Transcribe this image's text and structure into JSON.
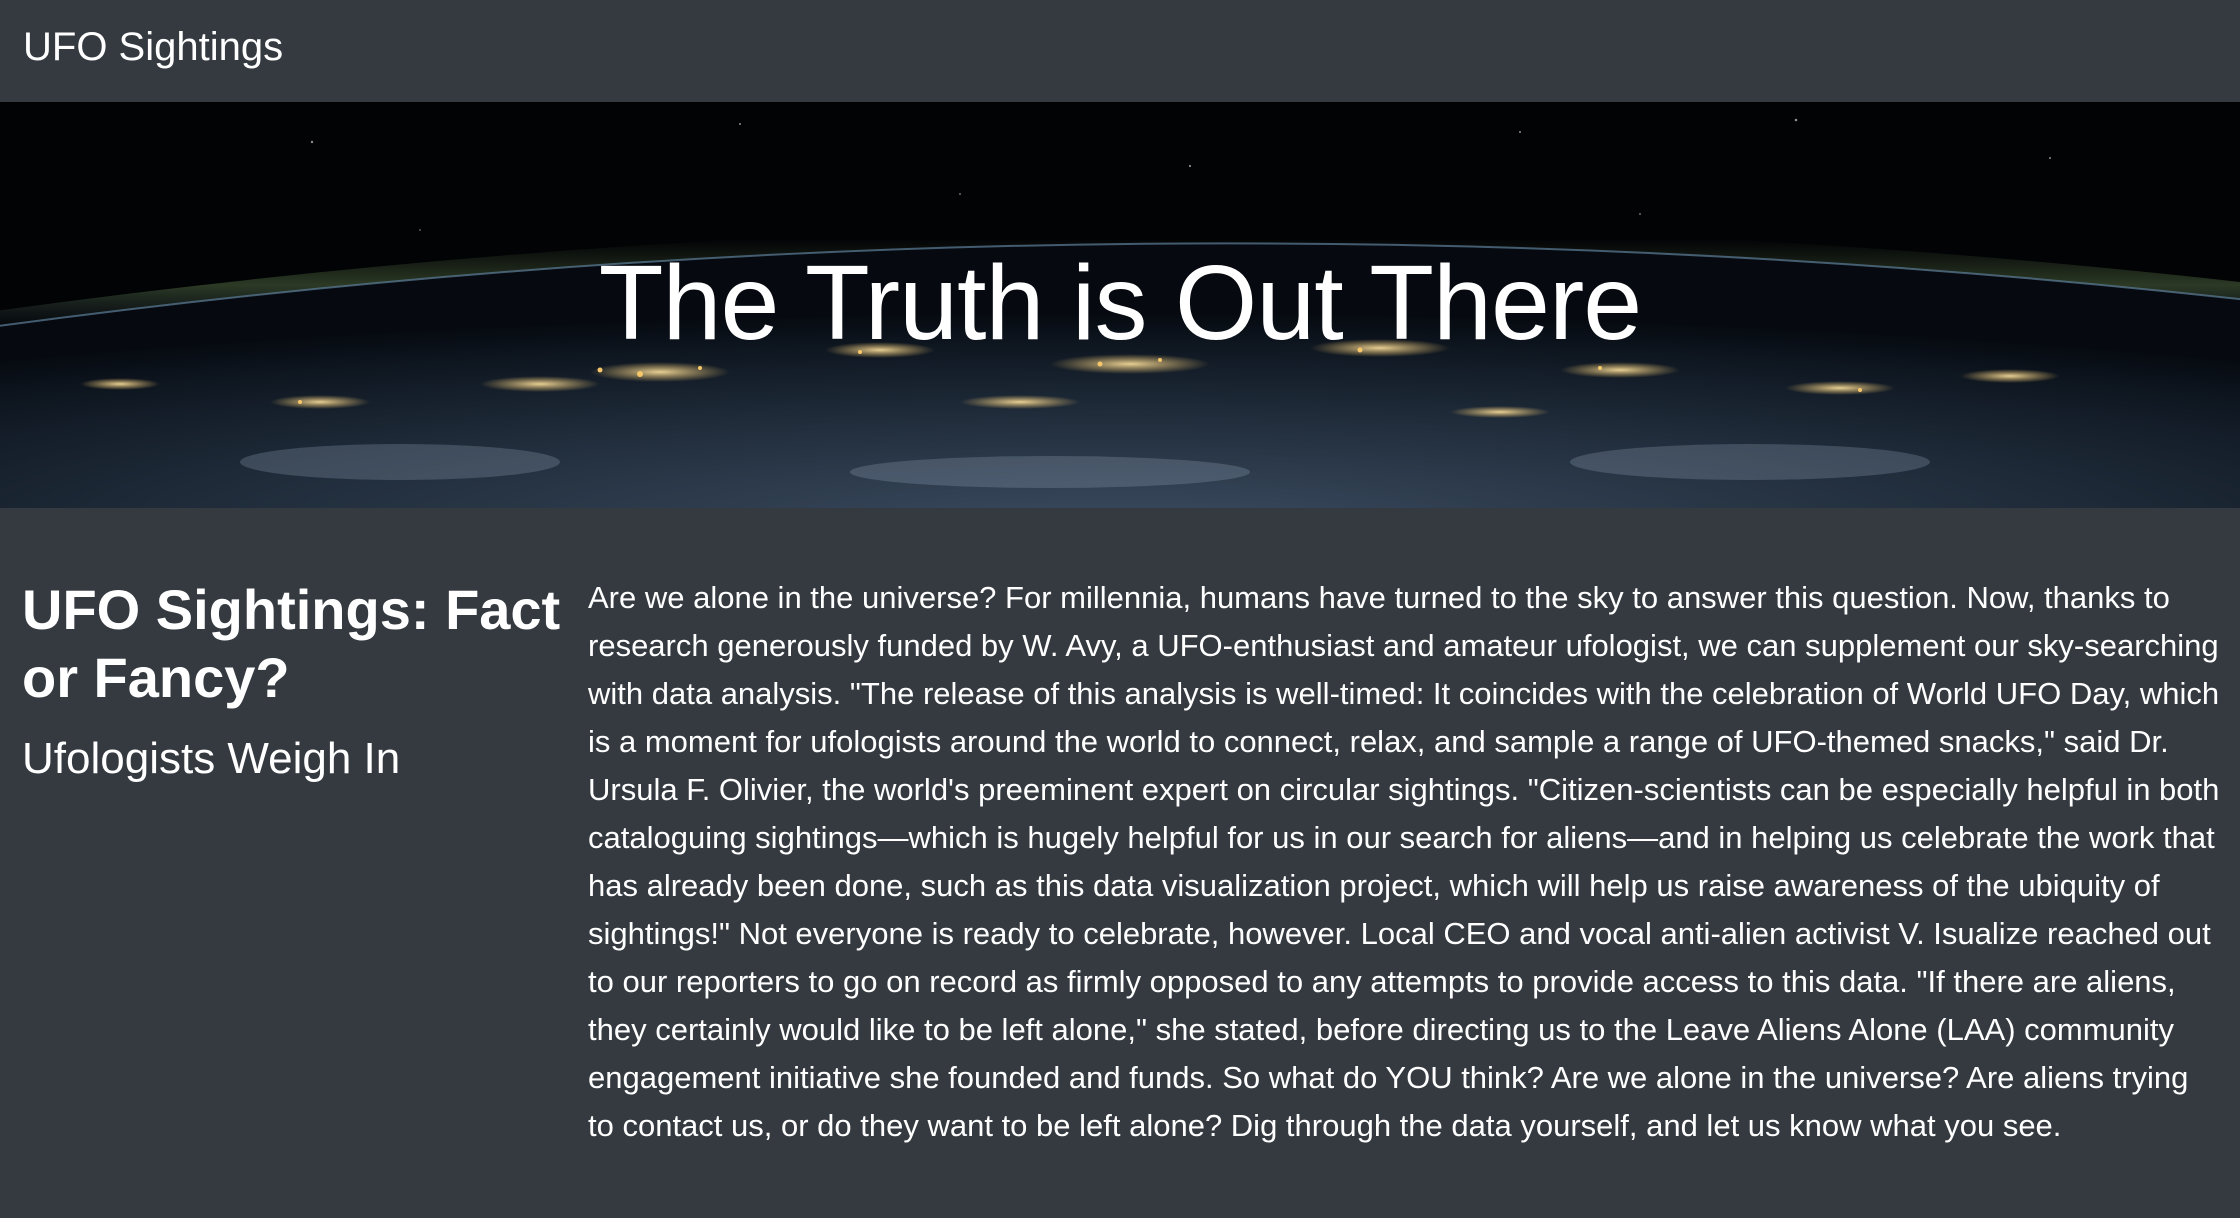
{
  "navbar": {
    "brand": "UFO Sightings"
  },
  "hero": {
    "title": "The Truth is Out There",
    "background": "earth-at-night-from-space"
  },
  "sidebar": {
    "heading": "UFO Sightings: Fact or Fancy?",
    "subheading": "Ufologists Weigh In"
  },
  "article": {
    "body": "Are we alone in the universe? For millennia, humans have turned to the sky to answer this question. Now, thanks to research generously funded by W. Avy, a UFO-enthusiast and amateur ufologist, we can supplement our sky-searching with data analysis. \"The release of this analysis is well-timed: It coincides with the celebration of World UFO Day, which is a moment for ufologists around the world to connect, relax, and sample a range of UFO-themed snacks,\" said Dr. Ursula F. Olivier, the world's preeminent expert on circular sightings. \"Citizen-scientists can be especially helpful in both cataloguing sightings—which is hugely helpful for us in our search for aliens—and in helping us celebrate the work that has already been done, such as this data visualization project, which will help us raise awareness of the ubiquity of sightings!\" Not everyone is ready to celebrate, however. Local CEO and vocal anti-alien activist V. Isualize reached out to our reporters to go on record as firmly opposed to any attempts to provide access to this data. \"If there are aliens, they certainly would like to be left alone,\" she stated, before directing us to the Leave Aliens Alone (LAA) community engagement initiative she founded and funds. So what do YOU think? Are we alone in the universe? Are aliens trying to contact us, or do they want to be left alone? Dig through the data yourself, and let us know what you see."
  },
  "colors": {
    "navbar_bg": "#343a40",
    "content_bg": "#343a40",
    "text": "#ffffff",
    "city_lights": "#f5c76a"
  }
}
